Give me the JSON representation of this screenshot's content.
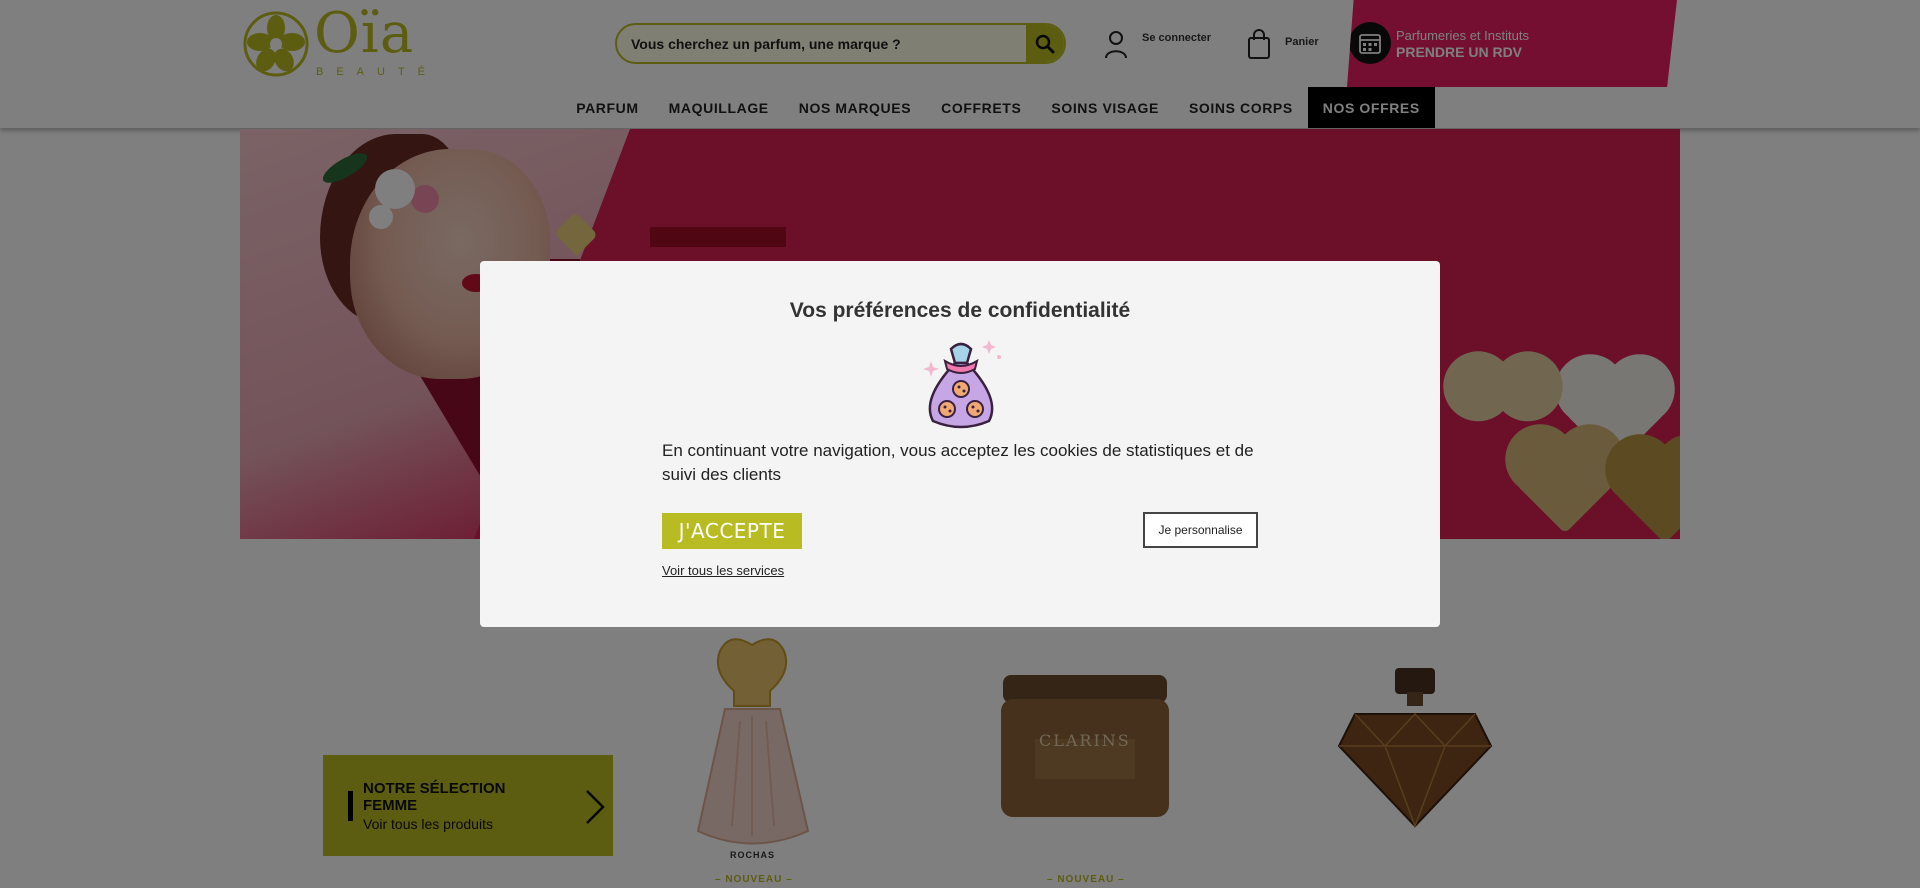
{
  "header": {
    "logo_text": "Oïa",
    "logo_subtitle": "BEAUTÉ",
    "search": {
      "placeholder": "Vous cherchez un parfum, une marque ?"
    },
    "account_label": "Se connecter",
    "cart_label": "Panier",
    "rdv": {
      "line1": "Parfumeries et Instituts",
      "line2": "PRENDRE UN RDV"
    }
  },
  "nav": {
    "items": [
      {
        "label": "PARFUM"
      },
      {
        "label": "MAQUILLAGE"
      },
      {
        "label": "NOS MARQUES"
      },
      {
        "label": "COFFRETS"
      },
      {
        "label": "SOINS VISAGE"
      },
      {
        "label": "SOINS CORPS"
      },
      {
        "label": "NOS OFFRES",
        "active": true
      }
    ]
  },
  "promo": {
    "title": "NOTRE SÉLECTION FEMME",
    "subtitle": "Voir tous les produits"
  },
  "products": [
    {
      "brand_label": "ROCHAS",
      "tag": "– NOUVEAU –"
    },
    {
      "brand_label": "CLARINS",
      "tag": "– NOUVEAU –"
    },
    {
      "brand_label": "",
      "tag": ""
    }
  ],
  "modal": {
    "title": "Vos préférences de confidentialité",
    "text": "En continuant votre navigation, vous acceptez les cookies de statistiques et de suivi des clients",
    "accept_label": "J'ACCEPTE",
    "personalize_label": "Je personnalise",
    "services_link": "Voir tous les services"
  },
  "colors": {
    "brand_yellow": "#b9bb22",
    "brand_pink": "#e81e64",
    "hero_red": "#d81e52",
    "nav_active_bg": "#000000"
  },
  "icons": [
    "search-icon",
    "user-icon",
    "cart-bag-icon",
    "calendar-icon",
    "cookie-bag-icon",
    "chevron-right-icon",
    "flower-icon"
  ]
}
